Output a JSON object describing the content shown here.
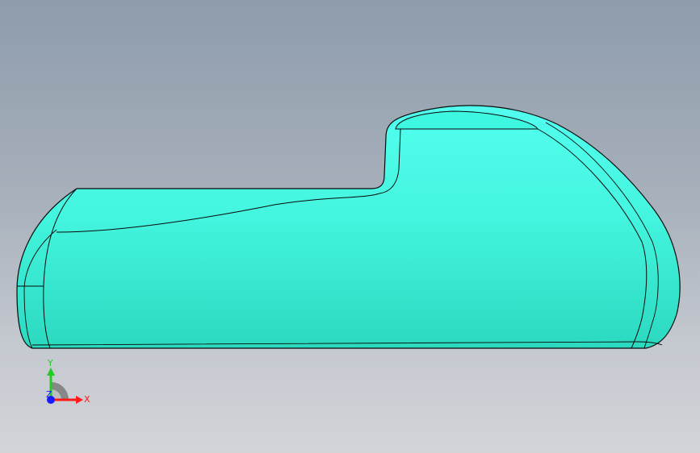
{
  "viewport": {
    "background_top": "#8e9cab",
    "background_bottom": "#d2d4d8",
    "model_color": "#3cf5dc",
    "edge_color": "#0a0a0a"
  },
  "triad": {
    "x_label": "X",
    "y_label": "Y",
    "z_label": "Z",
    "x_color": "#ff1a1a",
    "y_color": "#22cc22",
    "z_color": "#1a1aff"
  }
}
